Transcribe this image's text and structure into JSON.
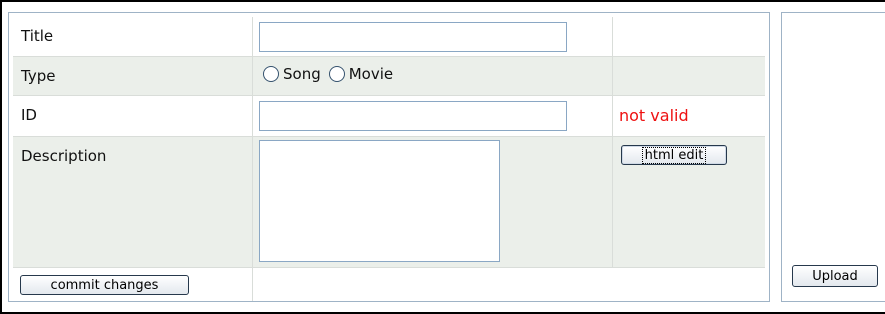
{
  "form": {
    "rows": [
      {
        "label": "Title"
      },
      {
        "label": "Type"
      },
      {
        "label": "ID"
      },
      {
        "label": "Description"
      }
    ],
    "title_value": "",
    "id_value": "",
    "description_value": "",
    "type_options": [
      "Song",
      "Movie"
    ],
    "id_error": "not valid",
    "html_edit_label": "html edit",
    "commit_label": "commit changes"
  },
  "side_panel": {
    "upload_label": "Upload"
  },
  "colors": {
    "alt_row": "#ebefea",
    "error": "#ee1111",
    "panel_border": "#9fb3c6",
    "input_border": "#8aa7c4"
  }
}
